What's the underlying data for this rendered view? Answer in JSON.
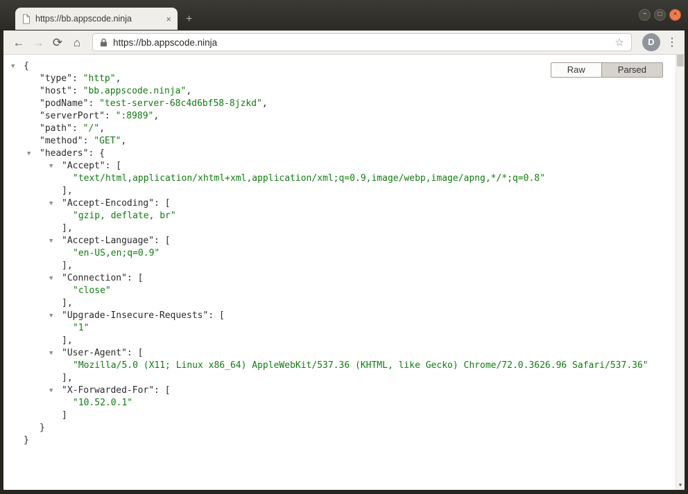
{
  "window": {
    "controls": {
      "minimize": "−",
      "maximize": "□",
      "close": "×"
    }
  },
  "tab": {
    "title": "https://bb.appscode.ninja",
    "close": "×",
    "new_tab": "+"
  },
  "toolbar": {
    "back": "←",
    "forward": "→",
    "reload": "⟳",
    "home": "⌂",
    "url": "https://bb.appscode.ninja",
    "bookmark_star": "☆",
    "avatar_initial": "D",
    "menu": "⋮"
  },
  "view_toggle": {
    "raw": "Raw",
    "parsed": "Parsed"
  },
  "icons": {
    "collapse": "▼",
    "scroll_down": "▼"
  },
  "json_view": {
    "lines": [
      {
        "pre": "{"
      },
      {
        "pre": "\"type\": ",
        "grn": "\"http\"",
        "post": ","
      },
      {
        "pre": "\"host\": ",
        "grn": "\"bb.appscode.ninja\"",
        "post": ","
      },
      {
        "pre": "\"podName\": ",
        "grn": "\"test-server-68c4d6bf58-8jzkd\"",
        "post": ","
      },
      {
        "pre": "\"serverPort\": ",
        "grn": "\":8989\"",
        "post": ","
      },
      {
        "pre": "\"path\": ",
        "grn": "\"/\"",
        "post": ","
      },
      {
        "pre": "\"method\": ",
        "grn": "\"GET\"",
        "post": ","
      },
      {
        "pre": "\"headers\": {"
      },
      {
        "pre": "\"Accept\": ["
      },
      {
        "grn": "\"text/html,application/xhtml+xml,application/xml;q=0.9,image/webp,image/apng,*/*;q=0.8\""
      },
      {
        "pre": "],"
      },
      {
        "pre": "\"Accept-Encoding\": ["
      },
      {
        "grn": "\"gzip, deflate, br\""
      },
      {
        "pre": "],"
      },
      {
        "pre": "\"Accept-Language\": ["
      },
      {
        "grn": "\"en-US,en;q=0.9\""
      },
      {
        "pre": "],"
      },
      {
        "pre": "\"Connection\": ["
      },
      {
        "grn": "\"close\""
      },
      {
        "pre": "],"
      },
      {
        "pre": "\"Upgrade-Insecure-Requests\": ["
      },
      {
        "grn": "\"1\""
      },
      {
        "pre": "],"
      },
      {
        "pre": "\"User-Agent\": ["
      },
      {
        "grn": "\"Mozilla/5.0 (X11; Linux x86_64) AppleWebKit/537.36 (KHTML, like Gecko) Chrome/72.0.3626.96 Safari/537.36\""
      },
      {
        "pre": "],"
      },
      {
        "pre": "\"X-Forwarded-For\": ["
      },
      {
        "grn": "\"10.52.0.1\""
      },
      {
        "pre": "]"
      },
      {
        "pre": "}"
      },
      {
        "pre": "}"
      }
    ]
  }
}
